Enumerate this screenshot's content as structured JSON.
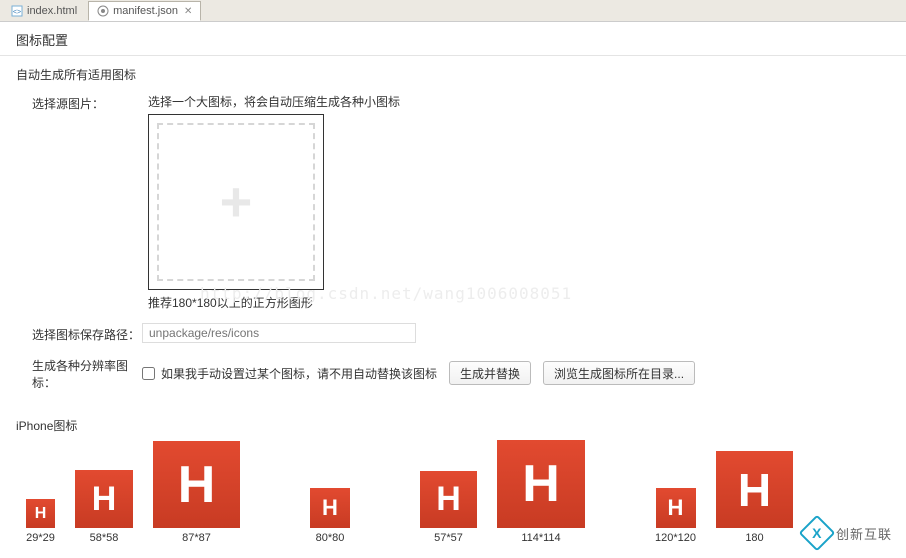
{
  "tabs": {
    "index": "index.html",
    "manifest": "manifest.json"
  },
  "page_title": "图标配置",
  "section_auto": "自动生成所有适用图标",
  "labels": {
    "source": "选择源图片：",
    "source_desc": "选择一个大图标，将会自动压缩生成各种小图标",
    "recommend": "推荐180*180以上的正方形图形",
    "save_path": "选择图标保存路径：",
    "save_path_placeholder": "unpackage/res/icons",
    "gen_each": "生成各种分辨率图标：",
    "checkbox_label": "如果我手动设置过某个图标，请不用自动替换该图标",
    "btn_gen": "生成并替换",
    "btn_browse": "浏览生成图标所在目录..."
  },
  "watermark": "http://blog.csdn.net/wang1006008051",
  "iphone_heading": "iPhone图标",
  "icons": {
    "i29": "29*29",
    "i58": "58*58",
    "i87": "87*87",
    "i80": "80*80",
    "i57": "57*57",
    "i114": "114*114",
    "i120": "120*120",
    "i180": "180"
  },
  "logo_text": "创新互联"
}
